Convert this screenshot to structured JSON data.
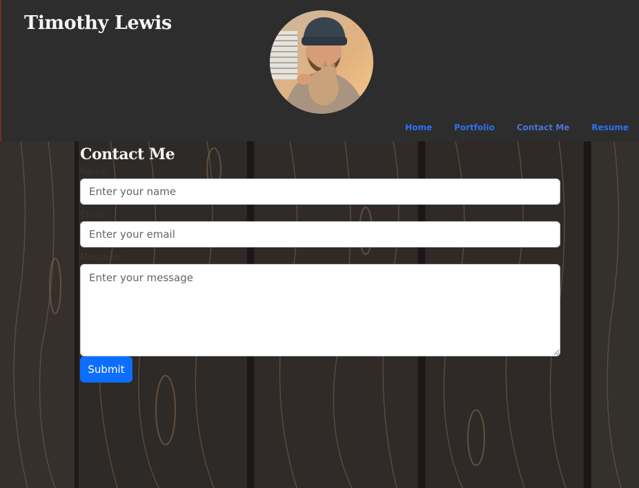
{
  "header": {
    "site_title": "Timothy Lewis",
    "avatar_alt": "profile photo",
    "nav": [
      {
        "label": "Home"
      },
      {
        "label": "Portfolio"
      },
      {
        "label": "Contact Me"
      },
      {
        "label": "Resume"
      }
    ]
  },
  "contact": {
    "title": "Contact Me",
    "name_label": "Name:",
    "name_placeholder": "Enter your name",
    "email_label": "Email:",
    "email_placeholder": "Enter your email",
    "message_label": "Message:",
    "message_placeholder": "Enter your message",
    "submit_label": "Submit"
  },
  "colors": {
    "header_bg": "#2d2d2d",
    "nav_link": "#2f6ff0",
    "submit_bg": "#0d6efd",
    "wood": "#2b2624"
  }
}
